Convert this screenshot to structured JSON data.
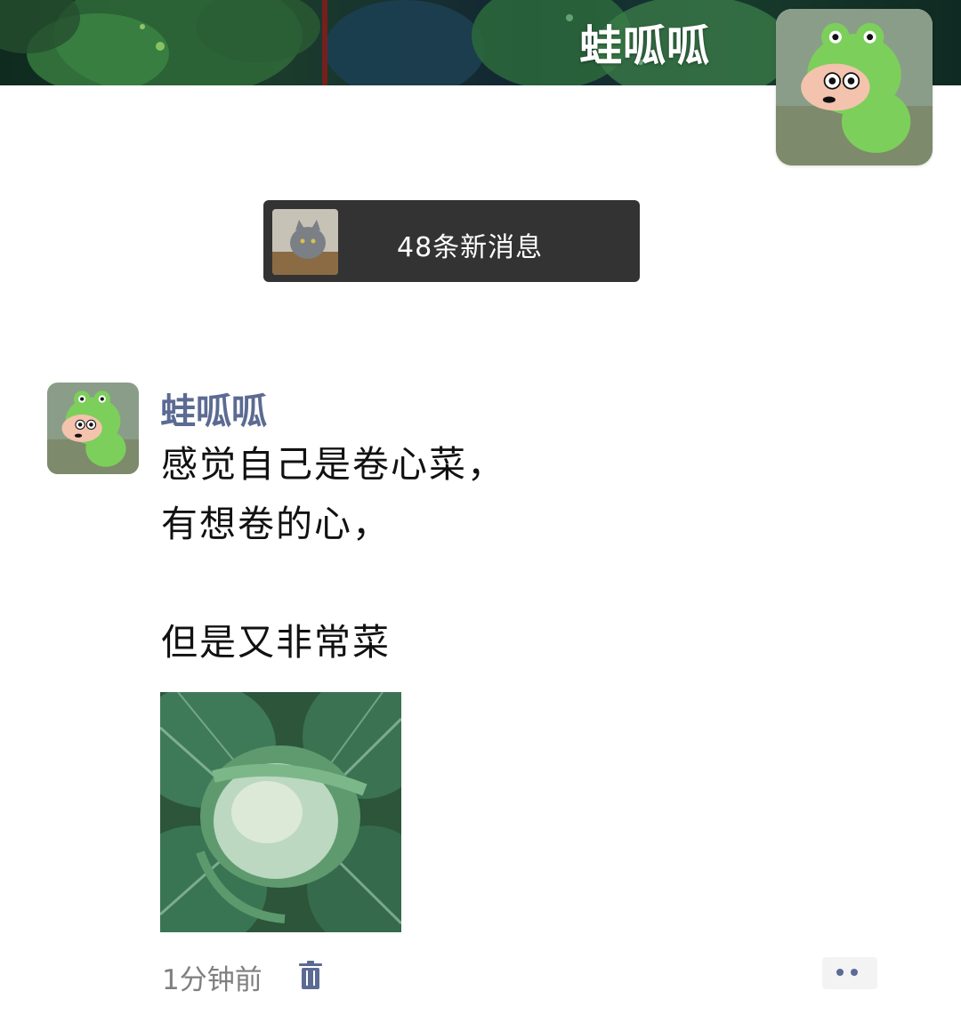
{
  "profile": {
    "name": "蛙呱呱",
    "avatar_icon": "frog-costume-cartoon-avatar"
  },
  "notifications": {
    "new_messages_text": "48条新消息",
    "sender_avatar_icon": "cat-photo-avatar"
  },
  "post": {
    "author": "蛙呱呱",
    "lines": [
      "感觉自己是卷心菜，",
      "有想卷的心，",
      "但是又非常菜"
    ],
    "image_icon": "cabbage-photo",
    "time": "1分钟前",
    "delete_icon": "trash-icon",
    "more_icon": "more-dots-icon"
  },
  "colors": {
    "author_name": "#5b6b93",
    "pill_background": "#333333",
    "timestamp": "#7f7f7f"
  }
}
